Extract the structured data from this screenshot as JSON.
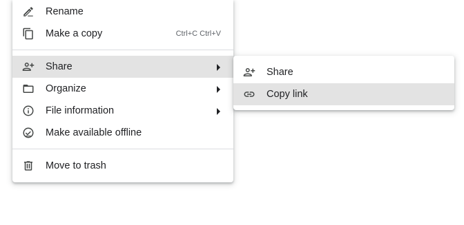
{
  "context_menu": {
    "items": [
      {
        "label": "Rename",
        "icon": "pencil-icon"
      },
      {
        "label": "Make a copy",
        "icon": "copy-icon",
        "shortcut": "Ctrl+C Ctrl+V"
      },
      {
        "label": "Share",
        "icon": "person-add-icon",
        "has_submenu": true,
        "highlighted": true
      },
      {
        "label": "Organize",
        "icon": "folder-open-icon",
        "has_submenu": true
      },
      {
        "label": "File information",
        "icon": "info-icon",
        "has_submenu": true
      },
      {
        "label": "Make available offline",
        "icon": "offline-check-icon"
      },
      {
        "label": "Move to trash",
        "icon": "trash-icon"
      }
    ]
  },
  "share_submenu": {
    "items": [
      {
        "label": "Share",
        "icon": "person-add-icon"
      },
      {
        "label": "Copy link",
        "icon": "link-icon",
        "highlighted": true
      }
    ]
  },
  "colors": {
    "highlight": "#e3e3e3",
    "text": "#202124",
    "icon": "#444746",
    "divider": "#dadce0"
  }
}
